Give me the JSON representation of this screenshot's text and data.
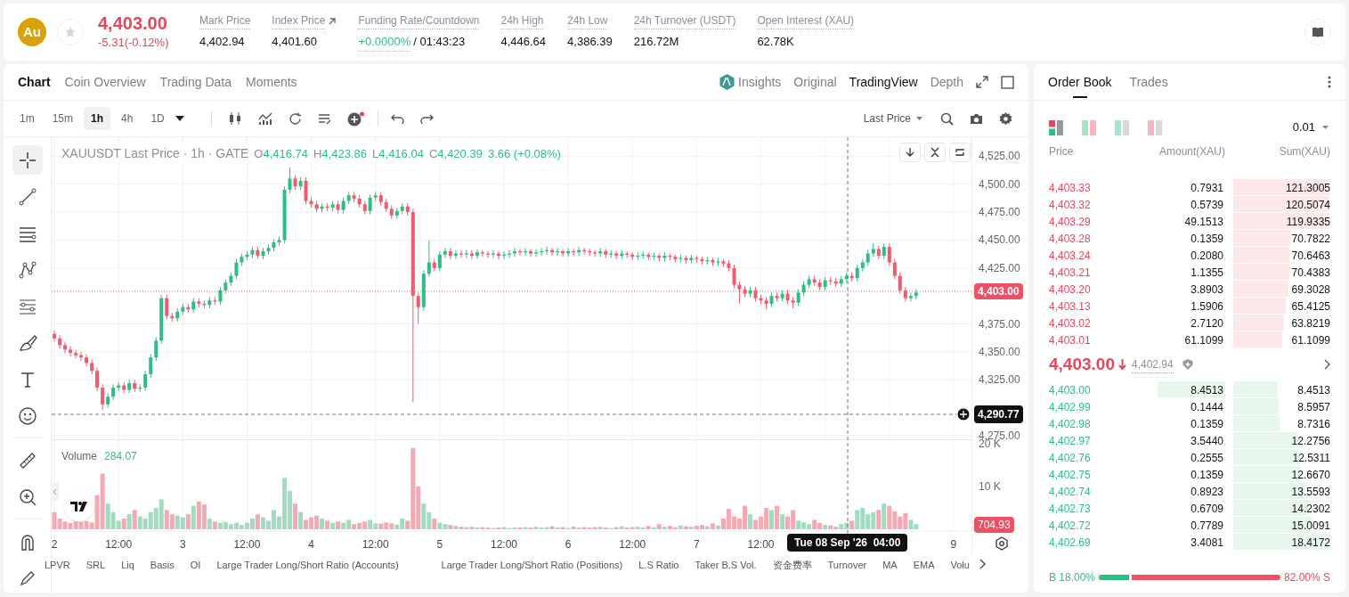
{
  "header": {
    "badge": "Au",
    "price": "4,403.00",
    "change": "-5.31(-0.12%)",
    "favorite": false,
    "stats": [
      {
        "kind": "plain",
        "label": "Mark Price",
        "value": "4,402.94"
      },
      {
        "kind": "link",
        "label": "Index Price",
        "value": "4,401.60"
      },
      {
        "kind": "rate",
        "label": "Funding Rate/Countdown",
        "value": "+0.0000%",
        "countdown": "/ 01:43:23"
      },
      {
        "kind": "plain",
        "label": "24h High",
        "value": "4,446.64"
      },
      {
        "kind": "plain",
        "label": "24h Low",
        "value": "4,386.39"
      },
      {
        "kind": "plain",
        "label": "24h Turnover (USDT)",
        "value": "216.72M"
      },
      {
        "kind": "plain",
        "label": "Open Interest (XAU)",
        "value": "62.78K"
      }
    ]
  },
  "chart_panel": {
    "tabs": [
      {
        "label": "Chart",
        "selected": true
      },
      {
        "label": "Coin Overview",
        "selected": false
      },
      {
        "label": "Trading Data",
        "selected": false
      },
      {
        "label": "Moments",
        "selected": false
      }
    ],
    "view_tabs": [
      {
        "kind": "ai",
        "label": "Insights",
        "selected": false
      },
      {
        "kind": "plain",
        "label": "Original",
        "selected": false
      },
      {
        "kind": "plain",
        "label": "TradingView",
        "selected": true
      },
      {
        "kind": "plain",
        "label": "Depth",
        "selected": false
      }
    ],
    "intervals": [
      {
        "label": "1m",
        "selected": false
      },
      {
        "label": "15m",
        "selected": false
      },
      {
        "label": "1h",
        "selected": true
      },
      {
        "label": "4h",
        "selected": false
      },
      {
        "label": "1D",
        "selected": false
      }
    ],
    "price_source": "Last Price",
    "drawing_tools": [
      {
        "kind": "crosshair",
        "selected": true
      },
      {
        "kind": "trendline",
        "selected": false
      },
      {
        "kind": "hlines",
        "selected": false
      },
      {
        "kind": "pattern",
        "selected": false
      },
      {
        "kind": "fib",
        "selected": false
      },
      {
        "kind": "brush",
        "selected": false
      },
      {
        "kind": "text",
        "selected": false
      },
      {
        "kind": "emoji",
        "selected": false
      },
      {
        "kind": "ruler",
        "selected": false
      },
      {
        "kind": "zoom",
        "selected": false
      },
      {
        "kind": "magnet",
        "selected": false
      },
      {
        "kind": "pencil",
        "selected": false
      }
    ],
    "legend": {
      "title": "XAUUSDT Last Price · 1h · GATE",
      "ohlc": [
        {
          "key": "O",
          "value": "4,416.74"
        },
        {
          "key": "H",
          "value": "4,423.86"
        },
        {
          "key": "L",
          "value": "4,416.04"
        },
        {
          "key": "C",
          "value": "4,420.39"
        }
      ],
      "change": "3.66 (+0.08%)"
    },
    "price_chart": {
      "chart_data": {
        "type": "candlestick",
        "grid": true,
        "xlim": [
          1.979,
          9.146
        ],
        "ylim": [
          4271,
          4542
        ],
        "x": [
          2,
          2.042,
          2.083,
          2.125,
          2.167,
          2.208,
          2.25,
          2.292,
          2.333,
          2.375,
          2.417,
          2.458,
          2.5,
          2.542,
          2.583,
          2.625,
          2.667,
          2.708,
          2.75,
          2.792,
          2.833,
          2.875,
          2.917,
          2.958,
          3,
          3.042,
          3.083,
          3.125,
          3.167,
          3.208,
          3.25,
          3.292,
          3.333,
          3.375,
          3.417,
          3.458,
          3.5,
          3.542,
          3.583,
          3.625,
          3.667,
          3.708,
          3.75,
          3.792,
          3.833,
          3.875,
          3.917,
          3.958,
          4,
          4.042,
          4.083,
          4.125,
          4.167,
          4.208,
          4.25,
          4.292,
          4.333,
          4.375,
          4.417,
          4.458,
          4.5,
          4.542,
          4.583,
          4.625,
          4.667,
          4.708,
          4.75,
          4.792,
          4.833,
          4.875,
          4.917,
          4.958,
          5,
          5.042,
          5.083,
          5.125,
          5.167,
          5.208,
          5.25,
          5.292,
          5.333,
          5.375,
          5.417,
          5.458,
          5.5,
          5.542,
          5.583,
          5.625,
          5.667,
          5.708,
          5.75,
          5.792,
          5.833,
          5.875,
          5.917,
          5.958,
          6,
          6.042,
          6.083,
          6.125,
          6.167,
          6.208,
          6.25,
          6.292,
          6.333,
          6.375,
          6.417,
          6.458,
          6.5,
          6.542,
          6.583,
          6.625,
          6.667,
          6.708,
          6.75,
          6.792,
          6.833,
          6.875,
          6.917,
          6.958,
          7,
          7.042,
          7.083,
          7.125,
          7.167,
          7.208,
          7.25,
          7.292,
          7.333,
          7.375,
          7.417,
          7.458,
          7.5,
          7.542,
          7.583,
          7.625,
          7.667,
          7.708,
          7.75,
          7.792,
          7.833,
          7.875,
          7.917,
          7.958,
          8,
          8.042,
          8.083,
          8.125,
          8.167,
          8.208,
          8.25,
          8.292,
          8.333,
          8.375,
          8.417,
          8.458,
          8.5,
          8.542,
          8.583,
          8.625,
          8.667,
          8.708
        ],
        "ohlc": [
          [
            4366,
            4369,
            4359,
            4362
          ],
          [
            4362,
            4365,
            4353,
            4356
          ],
          [
            4356,
            4359,
            4349,
            4352
          ],
          [
            4352,
            4355,
            4346,
            4349
          ],
          [
            4349,
            4352,
            4344,
            4347
          ],
          [
            4347,
            4350,
            4342,
            4345
          ],
          [
            4345,
            4348,
            4337,
            4340
          ],
          [
            4340,
            4343,
            4330,
            4333
          ],
          [
            4333,
            4336,
            4315,
            4318
          ],
          [
            4318,
            4321,
            4298,
            4303
          ],
          [
            4303,
            4313,
            4300,
            4310
          ],
          [
            4310,
            4321,
            4307,
            4318
          ],
          [
            4318,
            4323,
            4315,
            4320
          ],
          [
            4320,
            4323,
            4313,
            4316
          ],
          [
            4316,
            4325,
            4313,
            4322
          ],
          [
            4322,
            4325,
            4314,
            4317
          ],
          [
            4317,
            4321,
            4314,
            4318
          ],
          [
            4318,
            4333,
            4315,
            4330
          ],
          [
            4330,
            4348,
            4327,
            4345
          ],
          [
            4345,
            4363,
            4342,
            4360
          ],
          [
            4360,
            4401,
            4357,
            4398
          ],
          [
            4398,
            4401,
            4379,
            4382
          ],
          [
            4382,
            4385,
            4377,
            4380
          ],
          [
            4380,
            4389,
            4377,
            4386
          ],
          [
            4386,
            4393,
            4383,
            4390
          ],
          [
            4390,
            4393,
            4385,
            4388
          ],
          [
            4388,
            4398,
            4385,
            4395
          ],
          [
            4395,
            4398,
            4390,
            4393
          ],
          [
            4393,
            4396,
            4389,
            4392
          ],
          [
            4392,
            4399,
            4389,
            4396
          ],
          [
            4396,
            4399,
            4392,
            4395
          ],
          [
            4395,
            4408,
            4392,
            4405
          ],
          [
            4405,
            4415,
            4402,
            4412
          ],
          [
            4412,
            4421,
            4409,
            4418
          ],
          [
            4418,
            4433,
            4415,
            4430
          ],
          [
            4430,
            4438,
            4427,
            4435
          ],
          [
            4435,
            4440,
            4432,
            4437
          ],
          [
            4437,
            4444,
            4434,
            4441
          ],
          [
            4441,
            4444,
            4433,
            4436
          ],
          [
            4436,
            4443,
            4433,
            4440
          ],
          [
            4440,
            4446,
            4437,
            4443
          ],
          [
            4443,
            4451,
            4440,
            4448
          ],
          [
            4448,
            4453,
            4445,
            4450
          ],
          [
            4450,
            4498,
            4447,
            4495
          ],
          [
            4495,
            4515,
            4492,
            4505
          ],
          [
            4505,
            4508,
            4495,
            4498
          ],
          [
            4498,
            4506,
            4495,
            4503
          ],
          [
            4503,
            4506,
            4482,
            4485
          ],
          [
            4485,
            4488,
            4479,
            4482
          ],
          [
            4482,
            4485,
            4475,
            4478
          ],
          [
            4478,
            4483,
            4475,
            4480
          ],
          [
            4480,
            4483,
            4476,
            4479
          ],
          [
            4479,
            4485,
            4476,
            4482
          ],
          [
            4482,
            4485,
            4474,
            4477
          ],
          [
            4477,
            4488,
            4474,
            4485
          ],
          [
            4485,
            4493,
            4482,
            4490
          ],
          [
            4490,
            4493,
            4484,
            4487
          ],
          [
            4487,
            4490,
            4479,
            4482
          ],
          [
            4482,
            4485,
            4473,
            4476
          ],
          [
            4476,
            4491,
            4473,
            4488
          ],
          [
            4488,
            4493,
            4485,
            4490
          ],
          [
            4490,
            4493,
            4481,
            4484
          ],
          [
            4484,
            4487,
            4475,
            4478
          ],
          [
            4478,
            4481,
            4469,
            4472
          ],
          [
            4472,
            4479,
            4469,
            4476
          ],
          [
            4476,
            4483,
            4473,
            4480
          ],
          [
            4480,
            4483,
            4472,
            4475
          ],
          [
            4475,
            4478,
            4305,
            4400
          ],
          [
            4400,
            4403,
            4375,
            4390
          ],
          [
            4390,
            4423,
            4387,
            4420
          ],
          [
            4420,
            4450,
            4417,
            4430
          ],
          [
            4430,
            4433,
            4422,
            4425
          ],
          [
            4425,
            4440,
            4422,
            4437
          ],
          [
            4437,
            4443,
            4434,
            4440
          ],
          [
            4440,
            4443,
            4433,
            4436
          ],
          [
            4436,
            4441,
            4433,
            4438
          ],
          [
            4438,
            4441,
            4434,
            4437
          ],
          [
            4437,
            4441,
            4434,
            4438
          ],
          [
            4438,
            4441,
            4433,
            4436
          ],
          [
            4436,
            4442,
            4433,
            4439
          ],
          [
            4439,
            4441,
            4435,
            4438
          ],
          [
            4438,
            4440,
            4434,
            4437
          ],
          [
            4437,
            4441,
            4434,
            4438
          ],
          [
            4438,
            4440,
            4433,
            4436
          ],
          [
            4436,
            4440,
            4433,
            4437
          ],
          [
            4437,
            4441,
            4434,
            4438
          ],
          [
            4438,
            4443,
            4435,
            4440
          ],
          [
            4440,
            4442,
            4436,
            4439
          ],
          [
            4439,
            4443,
            4436,
            4440
          ],
          [
            4440,
            4442,
            4435,
            4438
          ],
          [
            4438,
            4442,
            4435,
            4439
          ],
          [
            4439,
            4443,
            4436,
            4440
          ],
          [
            4440,
            4444,
            4437,
            4441
          ],
          [
            4441,
            4443,
            4436,
            4439
          ],
          [
            4439,
            4443,
            4436,
            4440
          ],
          [
            4440,
            4442,
            4435,
            4438
          ],
          [
            4438,
            4443,
            4435,
            4440
          ],
          [
            4440,
            4442,
            4436,
            4439
          ],
          [
            4439,
            4444,
            4436,
            4441
          ],
          [
            4441,
            4443,
            4437,
            4440
          ],
          [
            4440,
            4442,
            4436,
            4439
          ],
          [
            4439,
            4441,
            4435,
            4438
          ],
          [
            4438,
            4443,
            4435,
            4440
          ],
          [
            4440,
            4442,
            4434,
            4437
          ],
          [
            4437,
            4441,
            4434,
            4438
          ],
          [
            4438,
            4440,
            4433,
            4436
          ],
          [
            4436,
            4441,
            4433,
            4438
          ],
          [
            4438,
            4440,
            4434,
            4437
          ],
          [
            4437,
            4439,
            4432,
            4435
          ],
          [
            4435,
            4439,
            4432,
            4436
          ],
          [
            4436,
            4440,
            4433,
            4437
          ],
          [
            4437,
            4439,
            4432,
            4435
          ],
          [
            4435,
            4439,
            4432,
            4436
          ],
          [
            4436,
            4438,
            4431,
            4434
          ],
          [
            4434,
            4439,
            4431,
            4436
          ],
          [
            4436,
            4438,
            4432,
            4435
          ],
          [
            4435,
            4437,
            4430,
            4433
          ],
          [
            4433,
            4437,
            4430,
            4434
          ],
          [
            4434,
            4436,
            4429,
            4432
          ],
          [
            4432,
            4437,
            4429,
            4434
          ],
          [
            4434,
            4436,
            4430,
            4433
          ],
          [
            4433,
            4435,
            4428,
            4431
          ],
          [
            4431,
            4435,
            4428,
            4432
          ],
          [
            4432,
            4434,
            4427,
            4430
          ],
          [
            4430,
            4434,
            4427,
            4431
          ],
          [
            4431,
            4433,
            4426,
            4429
          ],
          [
            4429,
            4432,
            4422,
            4425
          ],
          [
            4425,
            4428,
            4407,
            4410
          ],
          [
            4410,
            4413,
            4393,
            4406
          ],
          [
            4406,
            4409,
            4399,
            4402
          ],
          [
            4402,
            4408,
            4399,
            4405
          ],
          [
            4405,
            4408,
            4395,
            4398
          ],
          [
            4398,
            4401,
            4393,
            4396
          ],
          [
            4396,
            4399,
            4388,
            4393
          ],
          [
            4393,
            4403,
            4390,
            4400
          ],
          [
            4400,
            4403,
            4395,
            4398
          ],
          [
            4398,
            4405,
            4395,
            4402
          ],
          [
            4402,
            4405,
            4393,
            4396
          ],
          [
            4396,
            4399,
            4389,
            4394
          ],
          [
            4394,
            4406,
            4391,
            4403
          ],
          [
            4403,
            4413,
            4400,
            4410
          ],
          [
            4410,
            4418,
            4407,
            4415
          ],
          [
            4415,
            4418,
            4409,
            4412
          ],
          [
            4412,
            4415,
            4405,
            4408
          ],
          [
            4408,
            4417,
            4405,
            4414
          ],
          [
            4414,
            4417,
            4410,
            4413
          ],
          [
            4413,
            4416,
            4408,
            4411
          ],
          [
            4411,
            4418,
            4408,
            4415
          ],
          [
            4415,
            4421,
            4412,
            4418
          ],
          [
            4418,
            4421,
            4413,
            4416
          ],
          [
            4416,
            4428,
            4413,
            4425
          ],
          [
            4425,
            4433,
            4422,
            4430
          ],
          [
            4430,
            4441,
            4427,
            4438
          ],
          [
            4438,
            4447,
            4435,
            4442
          ],
          [
            4442,
            4445,
            4433,
            4436
          ],
          [
            4436,
            4447,
            4433,
            4444
          ],
          [
            4444,
            4447,
            4427,
            4430
          ],
          [
            4430,
            4433,
            4415,
            4418
          ],
          [
            4418,
            4421,
            4402,
            4405
          ],
          [
            4405,
            4408,
            4395,
            4398
          ],
          [
            4398,
            4403,
            4395,
            4400
          ],
          [
            4400,
            4406,
            4397,
            4403
          ]
        ],
        "yticks": [
          {
            "value": 4525,
            "label": "4,525.00"
          },
          {
            "value": 4500,
            "label": "4,500.00"
          },
          {
            "value": 4475,
            "label": "4,475.00"
          },
          {
            "value": 4450,
            "label": "4,450.00"
          },
          {
            "value": 4425,
            "label": "4,425.00"
          },
          {
            "value": 4375,
            "label": "4,375.00"
          },
          {
            "value": 4350,
            "label": "4,350.00"
          },
          {
            "value": 4325,
            "label": "4,325.00"
          },
          {
            "value": 4275,
            "label": "4,275.00"
          }
        ]
      }
    },
    "last_price": "4,403.00",
    "crosshair_price": "4,290.77",
    "volume": {
      "value": "284.07",
      "last": "704.93",
      "noon_labels": [
        "12:00",
        "12:00",
        "12:00",
        "12:00",
        "12:00",
        "12:00"
      ],
      "chart_data": {
        "type": "bar",
        "grid": true,
        "ylim": [
          0,
          20833
        ],
        "xlim": [
          1.979,
          9.146
        ],
        "x": [
          2,
          2.042,
          2.083,
          2.125,
          2.167,
          2.208,
          2.25,
          2.292,
          2.333,
          2.375,
          2.417,
          2.458,
          2.5,
          2.542,
          2.583,
          2.625,
          2.667,
          2.708,
          2.75,
          2.792,
          2.833,
          2.875,
          2.917,
          2.958,
          3,
          3.042,
          3.083,
          3.125,
          3.167,
          3.208,
          3.25,
          3.292,
          3.333,
          3.375,
          3.417,
          3.458,
          3.5,
          3.542,
          3.583,
          3.625,
          3.667,
          3.708,
          3.75,
          3.792,
          3.833,
          3.875,
          3.917,
          3.958,
          4,
          4.042,
          4.083,
          4.125,
          4.167,
          4.208,
          4.25,
          4.292,
          4.333,
          4.375,
          4.417,
          4.458,
          4.5,
          4.542,
          4.583,
          4.625,
          4.667,
          4.708,
          4.75,
          4.792,
          4.833,
          4.875,
          4.917,
          4.958,
          5,
          5.042,
          5.083,
          5.125,
          5.167,
          5.208,
          5.25,
          5.292,
          5.333,
          5.375,
          5.417,
          5.458,
          5.5,
          5.542,
          5.583,
          5.625,
          5.667,
          5.708,
          5.75,
          5.792,
          5.833,
          5.875,
          5.917,
          5.958,
          6,
          6.042,
          6.083,
          6.125,
          6.167,
          6.208,
          6.25,
          6.292,
          6.333,
          6.375,
          6.417,
          6.458,
          6.5,
          6.542,
          6.583,
          6.625,
          6.667,
          6.708,
          6.75,
          6.792,
          6.833,
          6.875,
          6.917,
          6.958,
          7,
          7.042,
          7.083,
          7.125,
          7.167,
          7.208,
          7.25,
          7.292,
          7.333,
          7.375,
          7.417,
          7.458,
          7.5,
          7.542,
          7.583,
          7.625,
          7.667,
          7.708,
          7.75,
          7.792,
          7.833,
          7.875,
          7.917,
          7.958,
          8,
          8.042,
          8.083,
          8.125,
          8.167,
          8.208,
          8.25,
          8.292,
          8.333,
          8.375,
          8.417,
          8.458,
          8.5,
          8.542,
          8.583,
          8.625,
          8.667,
          8.708
        ],
        "xticks": [
          {
            "value": 2,
            "label": "2"
          },
          {
            "value": 3,
            "label": "3"
          },
          {
            "value": 4,
            "label": "4"
          },
          {
            "value": 5,
            "label": "5"
          },
          {
            "value": 6,
            "label": "6"
          },
          {
            "value": 7,
            "label": "7"
          },
          {
            "value": 9,
            "label": "9"
          }
        ],
        "yticks": [
          {
            "value": 20000,
            "label": "20 K"
          },
          {
            "value": 10000,
            "label": "10 K"
          }
        ],
        "series": [
          {
            "name": "Volume",
            "values": [
              4000,
              2500,
              1800,
              1500,
              1800,
              1700,
              1900,
              1600,
              8000,
              13000,
              6000,
              4000,
              2000,
              2500,
              3500,
              4500,
              3000,
              2500,
              4000,
              5000,
              7000,
              4500,
              3500,
              3200,
              2800,
              3500,
              5500,
              6500,
              5800,
              2500,
              1800,
              1500,
              1700,
              1200,
              1500,
              1000,
              1500,
              2500,
              3500,
              2800,
              2000,
              4500,
              3000,
              12000,
              9000,
              6000,
              4000,
              2200,
              2800,
              3200,
              2500,
              2000,
              1500,
              1800,
              1500,
              2200,
              1200,
              1500,
              1800,
              2200,
              1400,
              1300,
              1600,
              1400,
              1100,
              2500,
              2000,
              19000,
              10000,
              6000,
              4000,
              2500,
              1500,
              1200,
              1000,
              800,
              600,
              500,
              600,
              400,
              500,
              400,
              300,
              400,
              500,
              300,
              400,
              400,
              500,
              400,
              600,
              400,
              500,
              700,
              400,
              500,
              300,
              600,
              400,
              500,
              400,
              500,
              600,
              400,
              300,
              500,
              700,
              400,
              500,
              600,
              400,
              800,
              500,
              1200,
              600,
              800,
              500,
              900,
              700,
              600,
              800,
              1000,
              700,
              1400,
              900,
              2500,
              4800,
              3000,
              2500,
              5500,
              3500,
              2200,
              3000,
              5000,
              4500,
              5500,
              3500,
              3000,
              4500,
              2000,
              1600,
              1200,
              2200,
              1500,
              1000,
              900,
              600,
              1200,
              1500,
              2000,
              4500,
              5000,
              3500,
              4000,
              4500,
              6000,
              5500,
              4200,
              3000,
              3800,
              2200,
              1200
            ]
          }
        ]
      }
    },
    "crosshair_time": "Tue 08 Sep '26  04:00",
    "indicators": [
      "LPVR",
      "SRL",
      "Liq",
      "Basis",
      "OI",
      "Large Trader Long/Short Ratio (Accounts)",
      "Large Trader Long/Short Ratio (Positions)",
      "L.S Ratio",
      "Taker B.S Vol.",
      "资金费率",
      "Turnover",
      "MA",
      "EMA",
      "Volu"
    ]
  },
  "order_book": {
    "tabs": [
      {
        "label": "Order Book",
        "selected": true
      },
      {
        "label": "Trades",
        "selected": false
      }
    ],
    "precision": "0.01",
    "columns": [
      "Price",
      "Amount(XAU)",
      "Sum(XAU)"
    ],
    "asks": [
      {
        "price": "4,403.33",
        "amount": "0.7931",
        "sum": "121.3005"
      },
      {
        "price": "4,403.32",
        "amount": "0.5739",
        "sum": "120.5074"
      },
      {
        "price": "4,403.29",
        "amount": "49.1513",
        "sum": "119.9335"
      },
      {
        "price": "4,403.28",
        "amount": "0.1359",
        "sum": "70.7822"
      },
      {
        "price": "4,403.24",
        "amount": "0.2080",
        "sum": "70.6463"
      },
      {
        "price": "4,403.21",
        "amount": "1.1355",
        "sum": "70.4383"
      },
      {
        "price": "4,403.20",
        "amount": "3.8903",
        "sum": "69.3028"
      },
      {
        "price": "4,403.13",
        "amount": "1.5906",
        "sum": "65.4125"
      },
      {
        "price": "4,403.02",
        "amount": "2.7120",
        "sum": "63.8219"
      },
      {
        "price": "4,403.01",
        "amount": "61.1099",
        "sum": "61.1099"
      }
    ],
    "mid": {
      "price": "4,403.00",
      "down": true,
      "mark": "4,402.94"
    },
    "bids": [
      {
        "price": "4,403.00",
        "amount": "8.4513",
        "sum": "8.4513",
        "amount_bar": true
      },
      {
        "price": "4,402.99",
        "amount": "0.1444",
        "sum": "8.5957",
        "amount_bar": false
      },
      {
        "price": "4,402.98",
        "amount": "0.1359",
        "sum": "8.7316",
        "amount_bar": false
      },
      {
        "price": "4,402.97",
        "amount": "3.5440",
        "sum": "12.2756",
        "amount_bar": false
      },
      {
        "price": "4,402.76",
        "amount": "0.2555",
        "sum": "12.5311",
        "amount_bar": false
      },
      {
        "price": "4,402.75",
        "amount": "0.1359",
        "sum": "12.6670",
        "amount_bar": false
      },
      {
        "price": "4,402.74",
        "amount": "0.8923",
        "sum": "13.5593",
        "amount_bar": false
      },
      {
        "price": "4,402.73",
        "amount": "0.6709",
        "sum": "14.2302",
        "amount_bar": false
      },
      {
        "price": "4,402.72",
        "amount": "0.7789",
        "sum": "15.0091",
        "amount_bar": false
      },
      {
        "price": "4,402.69",
        "amount": "3.4081",
        "sum": "18.4172",
        "amount_bar": false
      }
    ],
    "ratio": {
      "buy": "B 18.00%",
      "sell": "82.00% S",
      "level": 0.18
    }
  }
}
